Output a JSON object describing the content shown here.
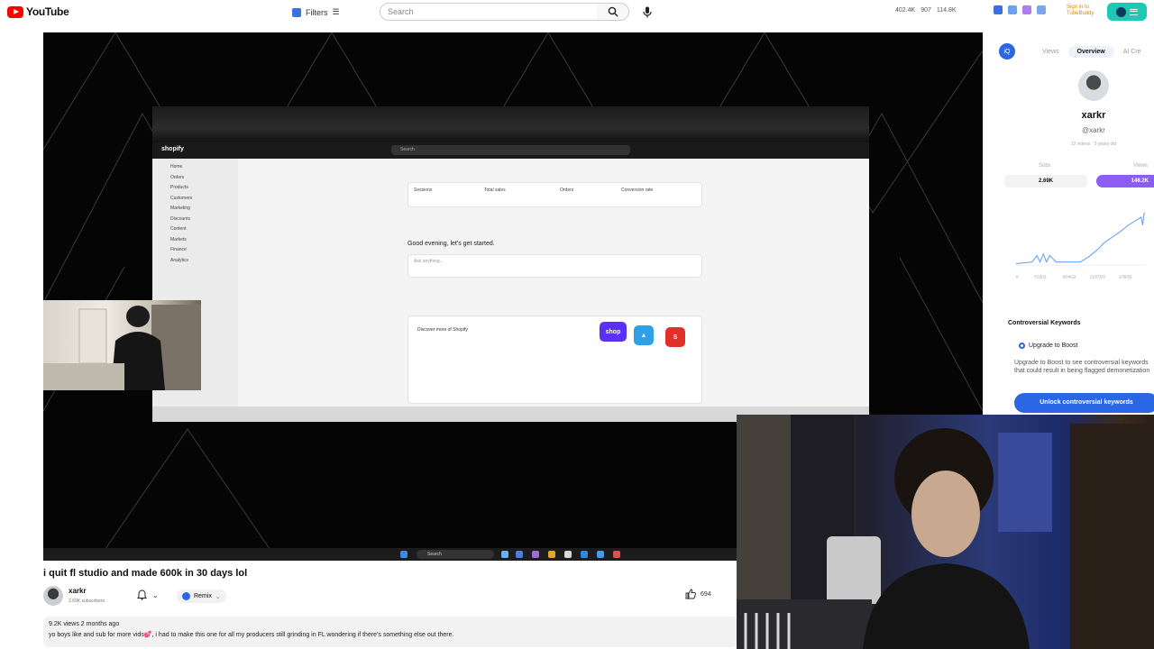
{
  "topbar": {
    "logo_text": "YouTube",
    "filters_label": "Filters",
    "search_placeholder": "Search",
    "stats": [
      "402.4K",
      "907",
      "114.8K"
    ],
    "signin_text": "Sign in to TubeBuddy",
    "accent": "#ff0000"
  },
  "player": {
    "shopify": {
      "logo": "shopify",
      "search": "Search",
      "greeting": "Good evening, let's get started.",
      "ask_placeholder": "Ask anything...",
      "sidebar": [
        "Home",
        "Orders",
        "Products",
        "Customers",
        "Marketing",
        "Discounts",
        "Content",
        "Markets",
        "Finance",
        "Analytics"
      ],
      "metrics": [
        "Sessions",
        "Total sales",
        "Orders",
        "Conversion rate"
      ],
      "discover_title": "Discover more of Shopify",
      "badges": [
        "shop",
        "S"
      ]
    },
    "taskbar_search": "Search"
  },
  "panel": {
    "logo": "iQ",
    "tabs": [
      "Views",
      "Overview",
      "AI Cre"
    ],
    "active_tab": "Overview",
    "channel_name": "xarkr",
    "channel_handle": "@xarkr",
    "channel_meta": "12 videos · 5 years old",
    "subs_label": "Subs",
    "views_label": "Views",
    "subs_value": "2.69K",
    "views_value": "148.2K",
    "chart_x_labels": [
      "0",
      "7/22/11",
      "9/24/22",
      "11/27/23",
      "1/30/25"
    ],
    "kw_title": "Controversial Keywords",
    "upgrade_title": "Upgrade to Boost",
    "upgrade_desc": "Upgrade to Boost to see controversial keywords that could result in being flagged demonetization",
    "unlock_label": "Unlock controversial keywords",
    "accent": "#2b66e4"
  },
  "video": {
    "title": "i quit fl studio and made 600k in 30 days lol",
    "channel": "xarkr",
    "subscribers": "2.69K subscribers",
    "remix_label": "Remix",
    "likes": "694",
    "views_date": "9.2K views  2 months ago",
    "description": "yo boys like and sub for more vids💕, i had to make this one for all my producers still grinding in FL wondering if there's something else out there."
  }
}
